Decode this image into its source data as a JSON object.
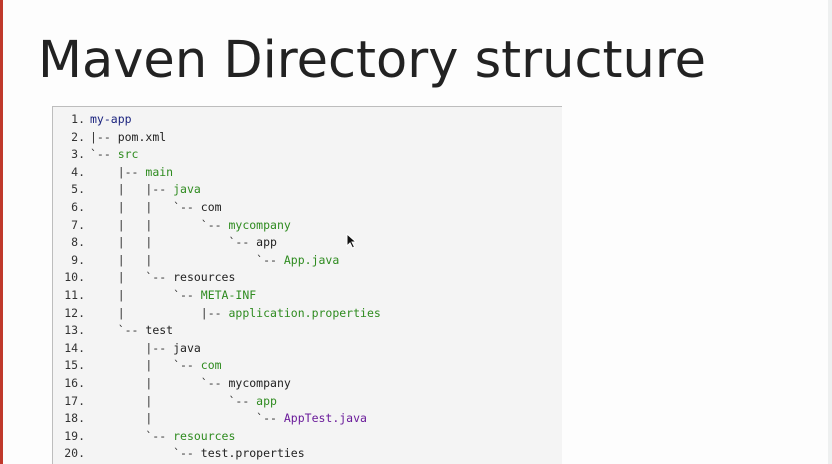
{
  "slide": {
    "title": "Maven Directory structure"
  },
  "code": {
    "lines": [
      {
        "num": "1.",
        "prefix": "",
        "name": "my-app",
        "kind": "root"
      },
      {
        "num": "2.",
        "prefix": "|-- ",
        "name": "pom.xml",
        "kind": "file"
      },
      {
        "num": "3.",
        "prefix": "`-- ",
        "name": "src",
        "kind": "dir"
      },
      {
        "num": "4.",
        "prefix": "    |-- ",
        "name": "main",
        "kind": "dir"
      },
      {
        "num": "5.",
        "prefix": "    |   |-- ",
        "name": "java",
        "kind": "dir"
      },
      {
        "num": "6.",
        "prefix": "    |   |   `-- ",
        "name": "com",
        "kind": "file"
      },
      {
        "num": "7.",
        "prefix": "    |   |       `-- ",
        "name": "mycompany",
        "kind": "dir"
      },
      {
        "num": "8.",
        "prefix": "    |   |           `-- ",
        "name": "app",
        "kind": "file"
      },
      {
        "num": "9.",
        "prefix": "    |   |               `-- ",
        "name": "App.java",
        "kind": "dir"
      },
      {
        "num": "10.",
        "prefix": "    |   `-- ",
        "name": "resources",
        "kind": "file"
      },
      {
        "num": "11.",
        "prefix": "    |       `-- ",
        "name": "META-INF",
        "kind": "dir"
      },
      {
        "num": "12.",
        "prefix": "    |           |-- ",
        "name": "application.properties",
        "kind": "dir"
      },
      {
        "num": "13.",
        "prefix": "    `-- ",
        "name": "test",
        "kind": "file"
      },
      {
        "num": "14.",
        "prefix": "        |-- ",
        "name": "java",
        "kind": "file"
      },
      {
        "num": "15.",
        "prefix": "        |   `-- ",
        "name": "com",
        "kind": "dir"
      },
      {
        "num": "16.",
        "prefix": "        |       `-- ",
        "name": "mycompany",
        "kind": "file"
      },
      {
        "num": "17.",
        "prefix": "        |           `-- ",
        "name": "app",
        "kind": "dir"
      },
      {
        "num": "18.",
        "prefix": "        |               `-- ",
        "name": "AppTest.java",
        "kind": "test"
      },
      {
        "num": "19.",
        "prefix": "        `-- ",
        "name": "resources",
        "kind": "dir"
      },
      {
        "num": "20.",
        "prefix": "            `-- ",
        "name": "test.properties",
        "kind": "file"
      }
    ]
  },
  "colors": {
    "directory_green": "#2e8b1f",
    "root_navy": "#1a237e",
    "test_purple": "#6a1b9a",
    "slide_accent_red": "#c0392b"
  },
  "icons": {
    "cursor": "mouse-pointer-icon"
  }
}
